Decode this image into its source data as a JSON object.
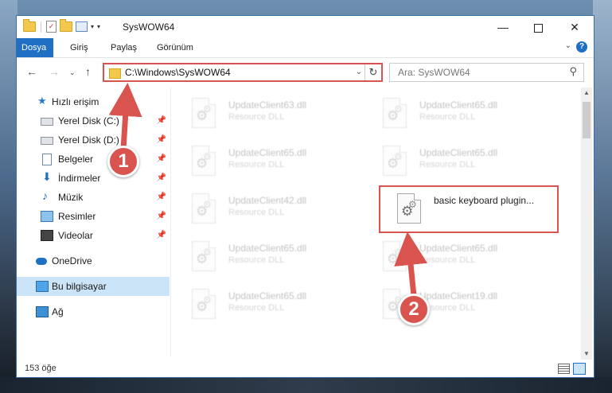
{
  "window": {
    "title": "SysWOW64",
    "minimize_glyph": "—",
    "close_glyph": "✕"
  },
  "ribbon": {
    "tabs": [
      "Dosya",
      "Giriş",
      "Paylaş",
      "Görünüm"
    ],
    "help_glyph": "?"
  },
  "address": {
    "path": "C:\\Windows\\SysWOW64",
    "refresh_glyph": "↻"
  },
  "search": {
    "placeholder": "Ara: SysWOW64"
  },
  "sidebar": {
    "items": [
      {
        "label": "Hızlı erişim",
        "icon": "star-icon"
      },
      {
        "label": "Yerel Disk (C:)",
        "icon": "drive-icon",
        "pinned": true
      },
      {
        "label": "Yerel Disk (D:)",
        "icon": "drive-icon",
        "pinned": true
      },
      {
        "label": "Belgeler",
        "icon": "documents-icon",
        "pinned": true
      },
      {
        "label": "İndirmeler",
        "icon": "download-icon",
        "pinned": true
      },
      {
        "label": "Müzik",
        "icon": "music-icon",
        "pinned": true
      },
      {
        "label": "Resimler",
        "icon": "pictures-icon",
        "pinned": true
      },
      {
        "label": "Videolar",
        "icon": "videos-icon",
        "pinned": true
      },
      {
        "label": "OneDrive",
        "icon": "onedrive-icon"
      },
      {
        "label": "Bu bilgisayar",
        "icon": "this-pc-icon",
        "selected": true
      },
      {
        "label": "Ağ",
        "icon": "network-icon"
      }
    ]
  },
  "files": [
    {
      "name": "UpdateClient63.dll",
      "type": "Resource DLL"
    },
    {
      "name": "UpdateClient65.dll",
      "type": "Resource DLL"
    },
    {
      "name": "UpdateClient65.dll",
      "type": "Resource DLL"
    },
    {
      "name": "UpdateClient65.dll",
      "type": "Resource DLL"
    },
    {
      "name": "UpdateClient42.dll",
      "type": "Resource DLL"
    },
    {
      "name": "basic keyboard plugin...",
      "type": ""
    },
    {
      "name": "UpdateClient65.dll",
      "type": "Resource DLL"
    },
    {
      "name": "UpdateClient65.dll",
      "type": "Resource DLL"
    },
    {
      "name": "UpdateClient65.dll",
      "type": "Resource DLL"
    },
    {
      "name": "UpdateClient19.dll",
      "type": "Resource DLL"
    }
  ],
  "status": {
    "item_count": "153 öğe"
  },
  "annotations": {
    "badge_1": "1",
    "badge_2": "2",
    "color": "#d9534f"
  }
}
